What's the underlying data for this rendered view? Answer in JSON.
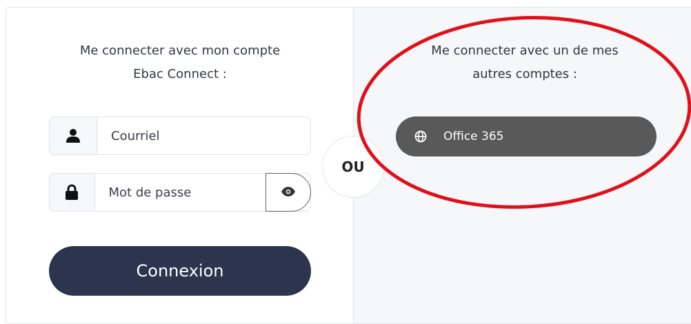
{
  "left": {
    "heading_line1": "Me connecter avec mon compte",
    "heading_line2": "Ebac Connect :",
    "email_placeholder": "Courriel",
    "password_placeholder": "Mot de passe",
    "submit_label": "Connexion"
  },
  "divider": {
    "label": "OU"
  },
  "right": {
    "heading_line1": "Me connecter avec un de mes",
    "heading_line2": "autres comptes :",
    "providers": [
      {
        "label": "Office 365",
        "icon": "globe-icon"
      }
    ]
  },
  "colors": {
    "primary_button": "#2c344e",
    "provider_button": "#595959",
    "annotation": "#e0101a"
  },
  "icons": {
    "email": "user-icon",
    "password": "lock-icon",
    "toggle": "eye-icon"
  }
}
